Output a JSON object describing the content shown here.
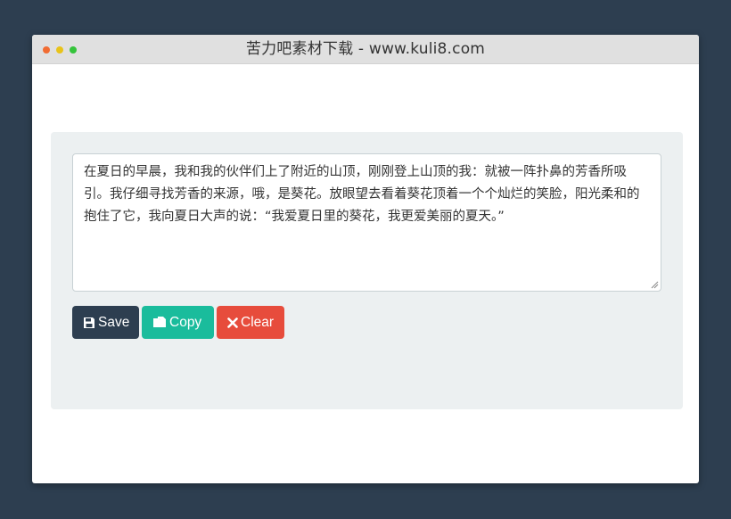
{
  "window": {
    "title": "苦力吧素材下载 - www.kuli8.com"
  },
  "editor": {
    "value": "在夏日的早晨，我和我的伙伴们上了附近的山顶，刚刚登上山顶的我：就被一阵扑鼻的芳香所吸引。我仔细寻找芳香的来源，哦，是葵花。放眼望去看着葵花顶着一个个灿烂的笑脸，阳光柔和的抱住了它，我向夏日大声的说：“我爱夏日里的葵花，我更爱美丽的夏天。”"
  },
  "toolbar": {
    "save_label": "Save",
    "save_icon": "floppy-disk-icon",
    "copy_label": "Copy",
    "copy_icon": "copy-icon",
    "clear_label": "Clear",
    "clear_icon": "x-icon"
  },
  "colors": {
    "background": "#2d3e50",
    "panel": "#ecf0f1",
    "save": "#2d3e50",
    "copy": "#1abc9c",
    "clear": "#e74c3c"
  }
}
